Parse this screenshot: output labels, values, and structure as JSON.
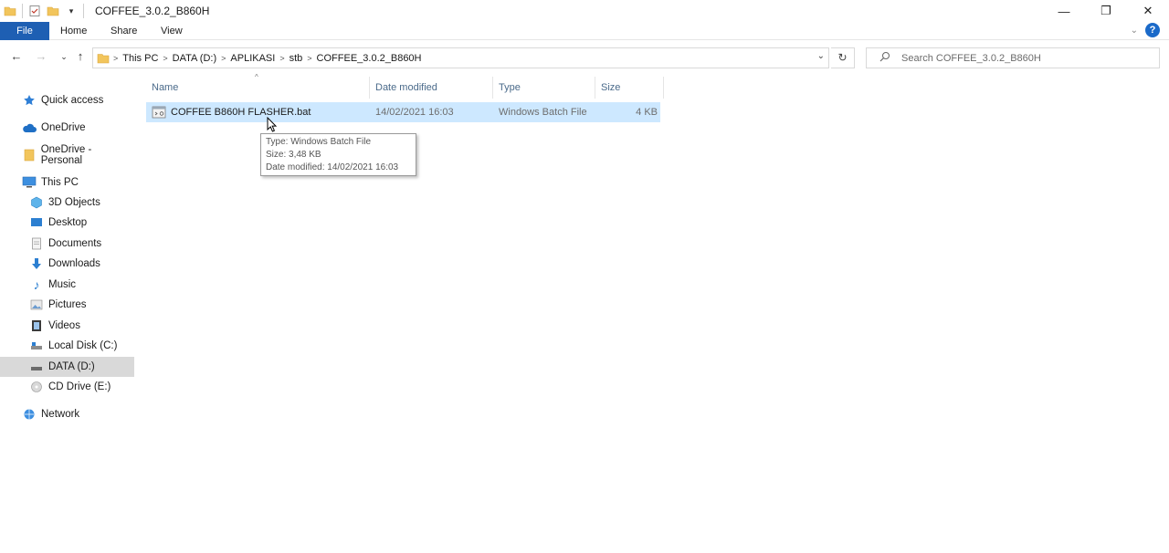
{
  "window": {
    "title": "COFFEE_3.0.2_B860H",
    "controls": {
      "minimize": "—",
      "restore": "❐",
      "close": "✕"
    }
  },
  "ribbon": {
    "tabs": [
      "File",
      "Home",
      "Share",
      "View"
    ],
    "help": "?"
  },
  "address": {
    "crumbs": [
      "This PC",
      "DATA (D:)",
      "APLIKASI",
      "stb",
      "COFFEE_3.0.2_B860H"
    ]
  },
  "search": {
    "placeholder": "Search COFFEE_3.0.2_B860H"
  },
  "nav": {
    "items": [
      {
        "label": "Quick access",
        "icon": "star-icon"
      },
      {
        "label": "OneDrive",
        "icon": "cloud-icon"
      },
      {
        "label": "OneDrive - Personal",
        "icon": "folder-icon"
      },
      {
        "label": "This PC",
        "icon": "computer-icon"
      },
      {
        "label": "3D Objects",
        "icon": "cube-icon"
      },
      {
        "label": "Desktop",
        "icon": "desktop-icon"
      },
      {
        "label": "Documents",
        "icon": "document-icon"
      },
      {
        "label": "Downloads",
        "icon": "download-arrow-icon"
      },
      {
        "label": "Music",
        "icon": "music-note-icon"
      },
      {
        "label": "Pictures",
        "icon": "picture-icon"
      },
      {
        "label": "Videos",
        "icon": "video-icon"
      },
      {
        "label": "Local Disk (C:)",
        "icon": "drive-icon"
      },
      {
        "label": "DATA (D:)",
        "icon": "drive-icon"
      },
      {
        "label": "CD Drive (E:)",
        "icon": "cd-drive-icon"
      },
      {
        "label": "Network",
        "icon": "network-icon"
      }
    ],
    "selected": "DATA (D:)"
  },
  "columns": [
    "Name",
    "Date modified",
    "Type",
    "Size"
  ],
  "files": [
    {
      "name": "COFFEE B860H FLASHER.bat",
      "date": "14/02/2021 16:03",
      "type": "Windows Batch File",
      "size": "4 KB",
      "icon": "batch-file-icon"
    }
  ],
  "tooltip": {
    "type": "Type: Windows Batch File",
    "size": "Size: 3,48 KB",
    "modified": "Date modified: 14/02/2021 16:03"
  },
  "colors": {
    "accent": "#1e5fb3",
    "selection": "#cde8ff",
    "nav_selected": "#d9d9d9"
  }
}
